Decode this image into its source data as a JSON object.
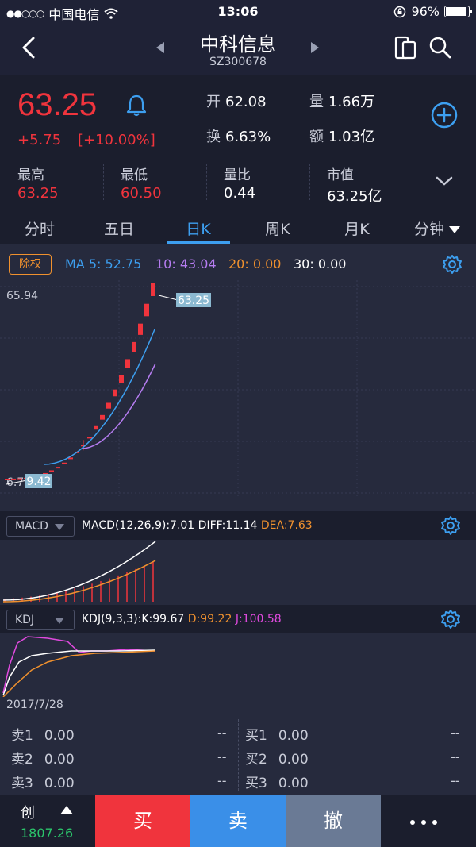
{
  "status_bar": {
    "signal": "●●○○○",
    "carrier": "中国电信",
    "time": "13:06",
    "battery": "96%",
    "battery_level": 0.96
  },
  "header": {
    "stock_name": "中科信息",
    "stock_code": "SZ300678"
  },
  "quote": {
    "price": "63.25",
    "change": "+5.75",
    "change_pct": "[+10.00%]",
    "open_label": "开",
    "open": "62.08",
    "volume_label": "量",
    "volume": "1.66万",
    "turnover_label": "换",
    "turnover": "6.63%",
    "amount_label": "额",
    "amount": "1.03亿",
    "high_label": "最高",
    "high": "63.25",
    "low_label": "最低",
    "low": "60.50",
    "vol_ratio_label": "量比",
    "vol_ratio": "0.44",
    "mkt_cap_label": "市值",
    "mkt_cap": "63.25亿"
  },
  "tabs": [
    {
      "label": "分时"
    },
    {
      "label": "五日"
    },
    {
      "label": "日K"
    },
    {
      "label": "周K"
    },
    {
      "label": "月K"
    },
    {
      "label": "分钟"
    }
  ],
  "kline": {
    "adjust_button": "除权",
    "ma5": "MA 5: 52.75",
    "ma10": "10: 43.04",
    "ma20": "20: 0.00",
    "ma30": "30: 0.00",
    "top_price": "65.94",
    "bottom_price": "6.73",
    "max_marker": "63.25",
    "min_marker": "9.42",
    "date": "2017/7/28"
  },
  "macd": {
    "name": "MACD",
    "params": "MACD(12,26,9):7.01",
    "diff": "DIFF:11.14",
    "dea": "DEA:7.63"
  },
  "kdj": {
    "name": "KDJ",
    "params": "KDJ(9,3,3):K:99.67",
    "d": "D:99.22",
    "j": "J:100.58"
  },
  "order_book": {
    "sell": [
      {
        "label": "卖1",
        "price": "0.00",
        "vol": "--"
      },
      {
        "label": "卖2",
        "price": "0.00",
        "vol": "--"
      },
      {
        "label": "卖3",
        "price": "0.00",
        "vol": "--"
      }
    ],
    "buy": [
      {
        "label": "买1",
        "price": "0.00",
        "vol": "--"
      },
      {
        "label": "买2",
        "price": "0.00",
        "vol": "--"
      },
      {
        "label": "买3",
        "price": "0.00",
        "vol": "--"
      }
    ]
  },
  "bottom_bar": {
    "board": "创",
    "index": "1807.26",
    "buy": "买",
    "sell": "卖",
    "cancel": "撤"
  },
  "colors": {
    "up": "#f0343d",
    "down": "#2bc46b",
    "accent": "#3d9ff0",
    "ma5": "#3d9ff0",
    "ma10": "#b57cf0",
    "ma20": "#f0912e",
    "ma30": "#ffffff"
  }
}
